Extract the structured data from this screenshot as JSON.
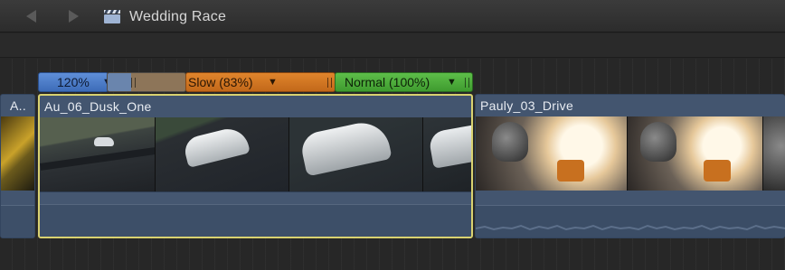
{
  "toolbar": {
    "back_icon": "back-arrow-icon",
    "forward_icon": "forward-arrow-icon",
    "project_icon": "clapperboard-icon",
    "project_title": "Wedding Race"
  },
  "retime": {
    "fast_label": "120%",
    "slow_label": "Slow (83%)",
    "normal_label": "Normal (100%)",
    "fast_color": "#4a7cc9",
    "slow_color": "#d27822",
    "normal_color": "#4cab3b"
  },
  "clips": {
    "a_name": "A..",
    "au_name": "Au_06_Dusk_One",
    "pauly_name": "Pauly_03_Drive",
    "selection_color": "#d9d270",
    "clip_color": "#43556f"
  }
}
